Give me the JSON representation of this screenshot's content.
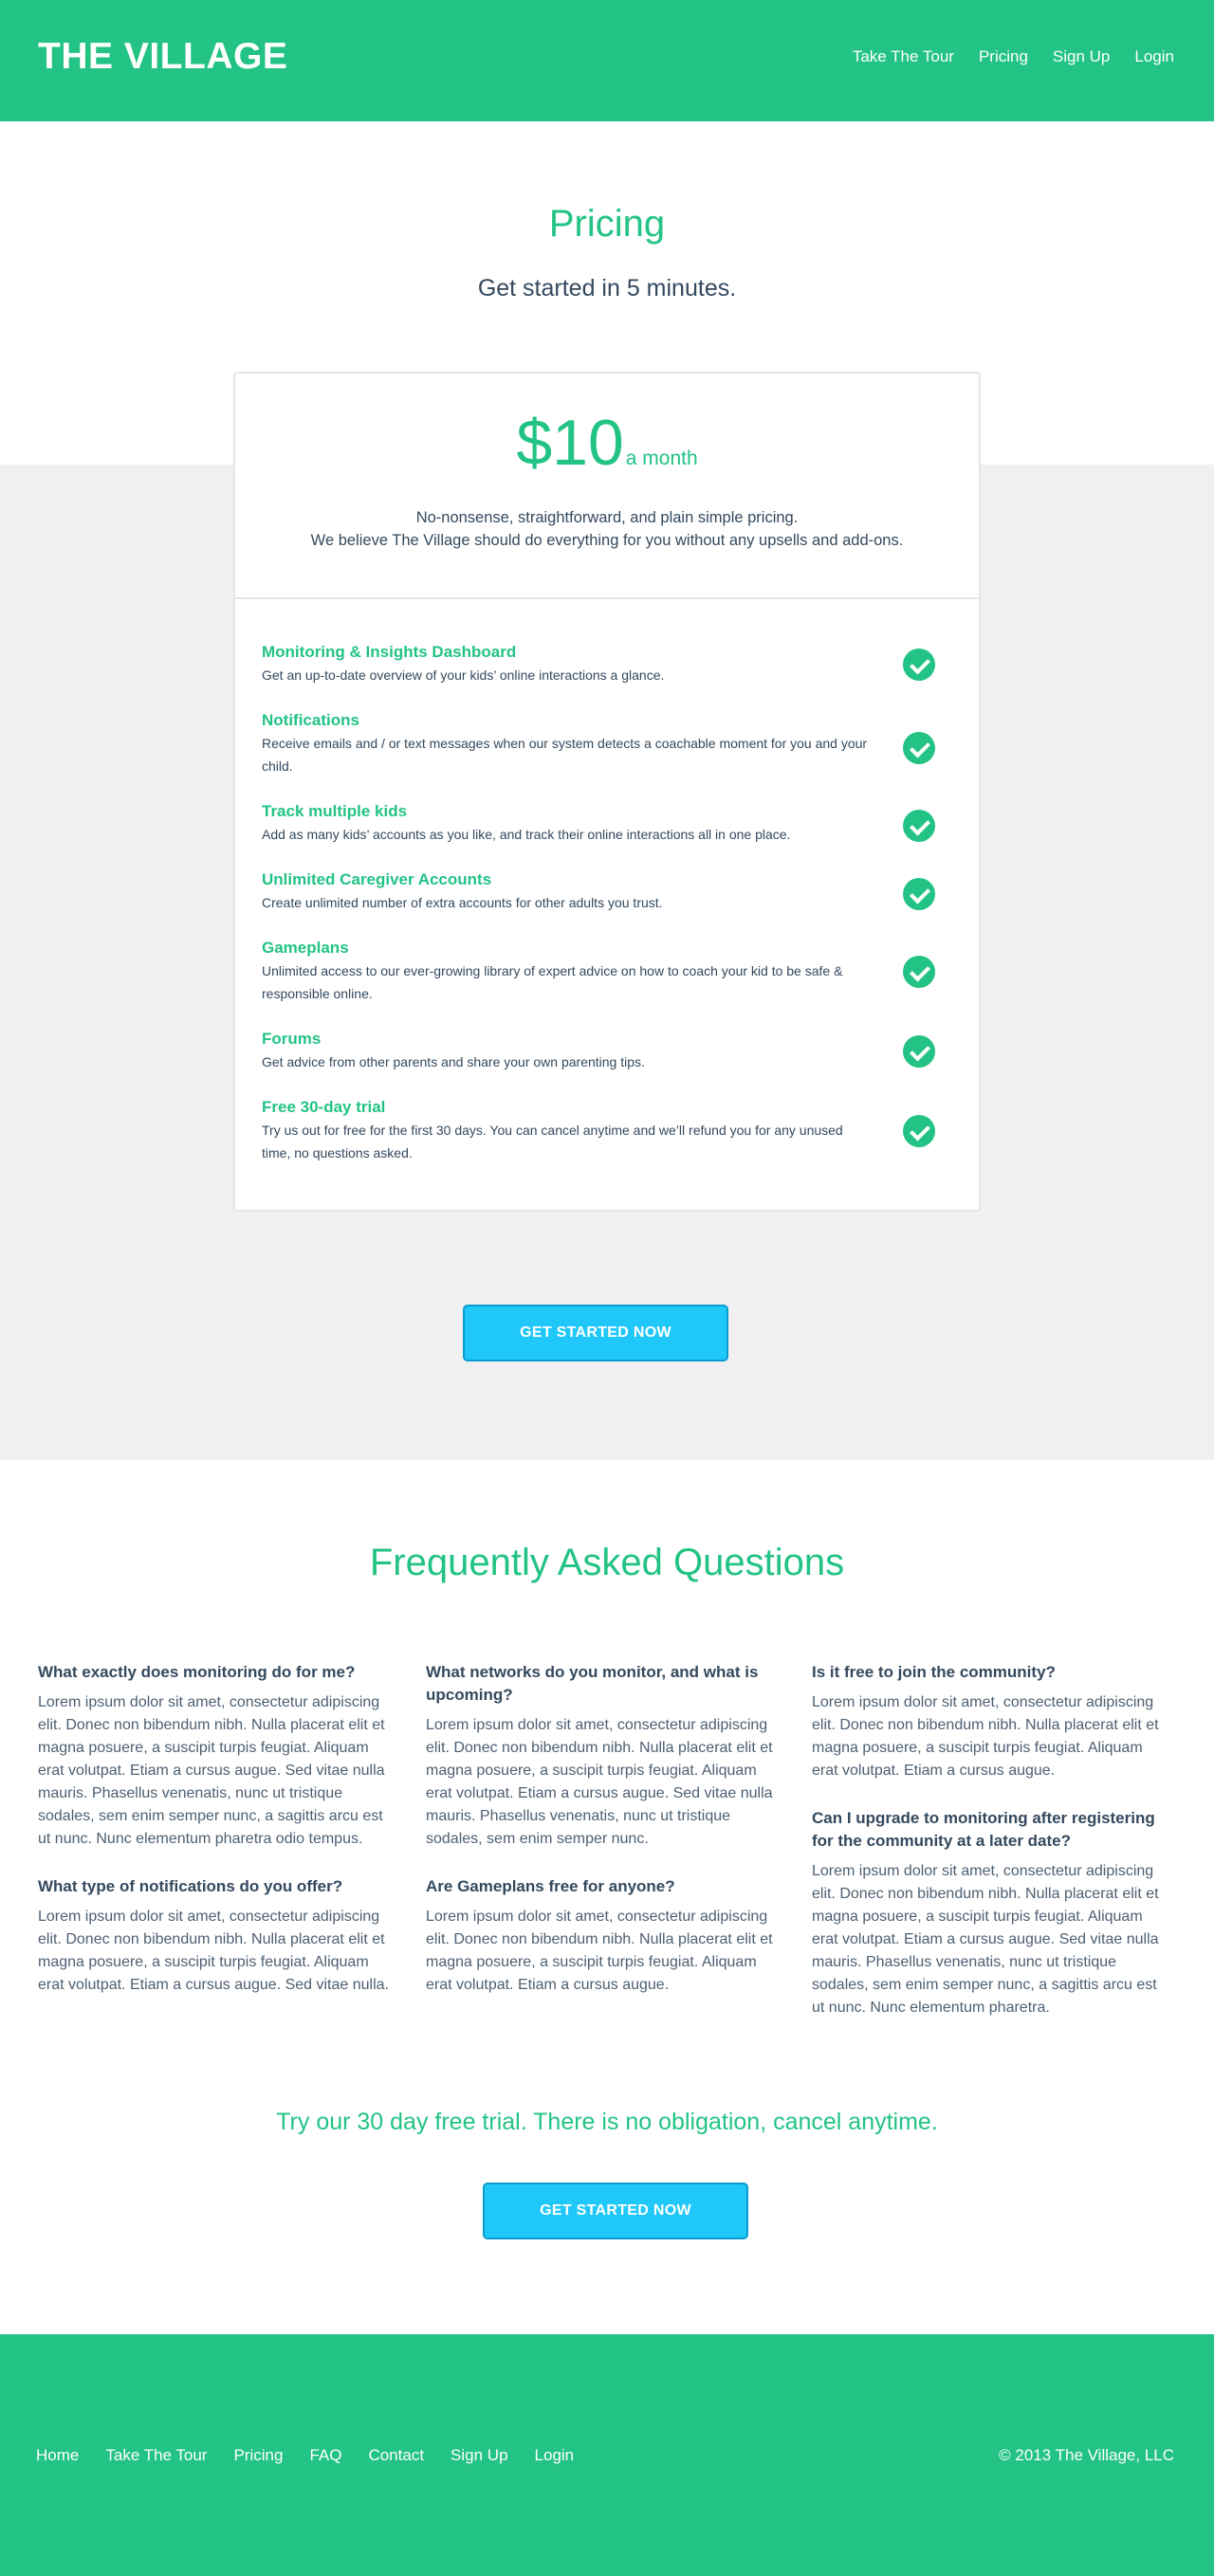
{
  "header": {
    "logo": "THE VILLAGE",
    "nav": [
      "Take The Tour",
      "Pricing",
      "Sign Up",
      "Login"
    ]
  },
  "pricing": {
    "title": "Pricing",
    "subtitle": "Get started in 5 minutes.",
    "amount": "$10",
    "period": "a month",
    "desc_line1": "No-nonsense, straightforward, and plain simple pricing.",
    "desc_line2": "We believe The Village should do everything for you without any upsells and add-ons.",
    "features": [
      {
        "title": "Monitoring & Insights Dashboard",
        "desc": "Get an up-to-date overview of your kids’ online interactions a glance."
      },
      {
        "title": "Notifications",
        "desc": "Receive emails and / or text messages when our system detects a coachable moment for you and your child."
      },
      {
        "title": "Track multiple kids",
        "desc": "Add as many kids’ accounts as you like, and track their online interactions all in one place."
      },
      {
        "title": "Unlimited Caregiver Accounts",
        "desc": "Create unlimited number of extra accounts for other adults you trust."
      },
      {
        "title": "Gameplans",
        "desc": "Unlimited access to our ever-growing library of expert advice on how to coach your kid to be safe & responsible online."
      },
      {
        "title": "Forums",
        "desc": "Get advice from other parents and share your own parenting tips."
      },
      {
        "title": "Free 30-day trial",
        "desc": "Try us out for free for the first 30 days. You can cancel anytime and we’ll refund you for any unused time, no questions asked."
      }
    ],
    "cta": "GET STARTED NOW"
  },
  "faq": {
    "title": "Frequently Asked Questions",
    "col1": [
      {
        "q": "What exactly does monitoring do for me?",
        "a": "Lorem ipsum dolor sit amet, consectetur adipiscing elit. Donec non bibendum nibh. Nulla placerat elit et magna posuere, a suscipit turpis feugiat. Aliquam erat volutpat. Etiam a cursus augue. Sed vitae nulla mauris. Phasellus venenatis, nunc ut tristique sodales, sem enim semper nunc, a sagittis arcu est ut nunc. Nunc elementum pharetra odio tempus."
      },
      {
        "q": "What type of notifications do you offer?",
        "a": "Lorem ipsum dolor sit amet, consectetur adipiscing elit. Donec non bibendum nibh. Nulla placerat elit et magna posuere, a suscipit turpis feugiat. Aliquam erat volutpat. Etiam a cursus augue. Sed vitae nulla."
      }
    ],
    "col2": [
      {
        "q": "What networks do you monitor, and what is upcoming?",
        "a": "Lorem ipsum dolor sit amet, consectetur adipiscing elit. Donec non bibendum nibh. Nulla placerat elit et magna posuere, a suscipit turpis feugiat. Aliquam erat volutpat. Etiam a cursus augue. Sed vitae nulla mauris. Phasellus venenatis, nunc ut tristique sodales, sem enim semper nunc."
      },
      {
        "q": "Are Gameplans free for anyone?",
        "a": "Lorem ipsum dolor sit amet, consectetur adipiscing elit. Donec non bibendum nibh. Nulla placerat elit et magna posuere, a suscipit turpis feugiat. Aliquam erat volutpat. Etiam a cursus augue."
      }
    ],
    "col3": [
      {
        "q": "Is it free to join the community?",
        "a": "Lorem ipsum dolor sit amet, consectetur adipiscing elit. Donec non bibendum nibh. Nulla placerat elit et magna posuere, a suscipit turpis feugiat. Aliquam erat volutpat. Etiam a cursus augue."
      },
      {
        "q": "Can I upgrade to monitoring after registering for the community at a later date?",
        "a": "Lorem ipsum dolor sit amet, consectetur adipiscing elit. Donec non bibendum nibh. Nulla placerat elit et magna posuere, a suscipit turpis feugiat. Aliquam erat volutpat. Etiam a cursus augue. Sed vitae nulla mauris. Phasellus venenatis, nunc ut tristique sodales, sem enim semper nunc, a sagittis arcu est ut nunc. Nunc elementum pharetra."
      }
    ]
  },
  "trial": {
    "text": "Try our 30 day free trial. There is no obligation, cancel anytime.",
    "cta": "GET STARTED NOW"
  },
  "footer": {
    "nav": [
      "Home",
      "Take The Tour",
      "Pricing",
      "FAQ",
      "Contact",
      "Sign Up",
      "Login"
    ],
    "copyright": "© 2013 The Village, LLC"
  },
  "colors": {
    "brand_green": "#22c384",
    "button_blue": "#1fc8f8",
    "text_dark": "#34495e",
    "band_gray": "#f0f0f0"
  }
}
